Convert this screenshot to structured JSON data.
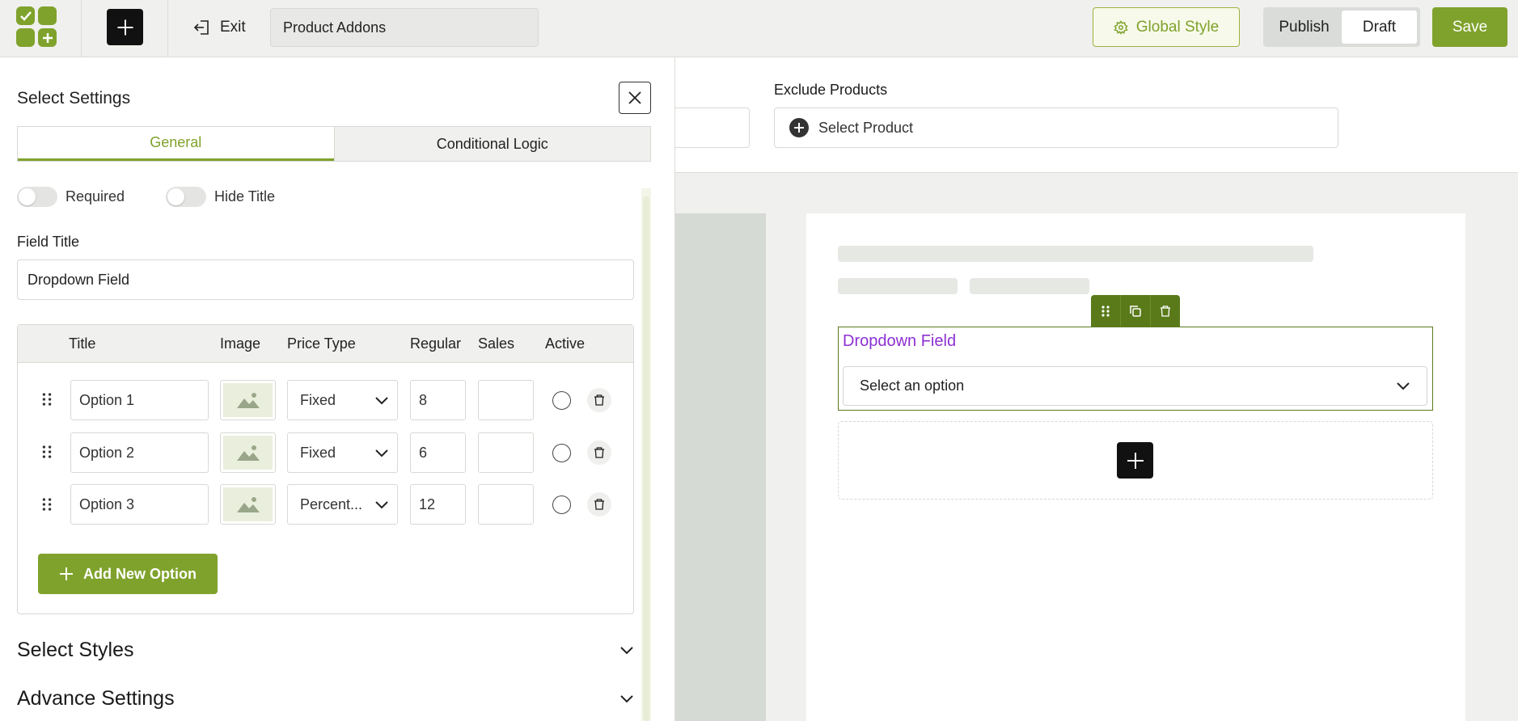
{
  "topbar": {
    "exit_label": "Exit",
    "product_title": "Product Addons",
    "global_style_label": "Global Style",
    "publish_label": "Publish",
    "draft_label": "Draft",
    "save_label": "Save",
    "accent_color": "#7fa22c"
  },
  "canvas": {
    "exclude_products_label": "Exclude Products",
    "select_product_label": "Select Product",
    "preview_field": {
      "title": "Dropdown Field",
      "placeholder": "Select an option",
      "title_color": "#8d2fd3"
    }
  },
  "panel": {
    "title": "Select Settings",
    "tabs": [
      {
        "label": "General",
        "active": true
      },
      {
        "label": "Conditional Logic",
        "active": false
      }
    ],
    "toggles": [
      {
        "label": "Required",
        "on": false
      },
      {
        "label": "Hide Title",
        "on": false
      }
    ],
    "field_title_label": "Field Title",
    "field_title_value": "Dropdown Field",
    "table": {
      "headers": [
        "Title",
        "Image",
        "Price Type",
        "Regular",
        "Sales",
        "Active"
      ],
      "rows": [
        {
          "title": "Option 1",
          "price_type": "Fixed",
          "regular": "8",
          "sales": ""
        },
        {
          "title": "Option 2",
          "price_type": "Fixed",
          "regular": "6",
          "sales": ""
        },
        {
          "title": "Option 3",
          "price_type": "Percent...",
          "regular": "12",
          "sales": ""
        }
      ]
    },
    "add_option_label": "Add New Option",
    "sections": [
      "Select Styles",
      "Advance Settings"
    ]
  }
}
